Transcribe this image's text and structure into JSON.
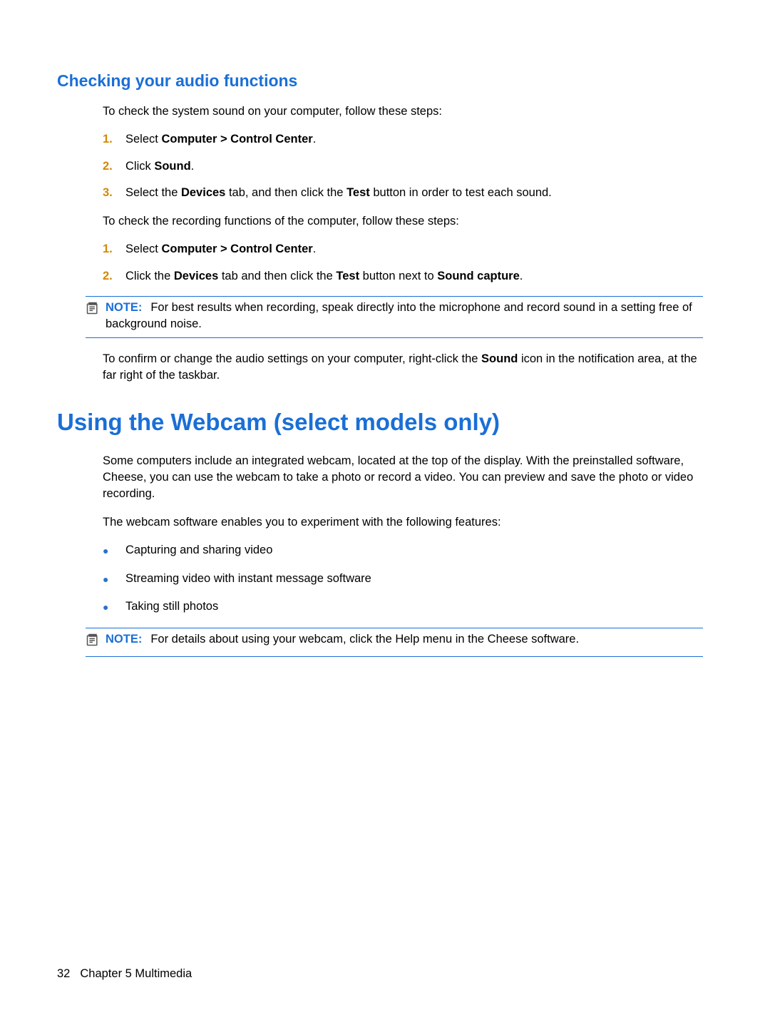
{
  "section1": {
    "heading": "Checking your audio functions",
    "intro": "To check the system sound on your computer, follow these steps:",
    "steps_a": [
      {
        "num": "1.",
        "pre": "Select ",
        "bold": "Computer > Control Center",
        "post": "."
      },
      {
        "num": "2.",
        "pre": "Click ",
        "bold": "Sound",
        "post": "."
      },
      {
        "num": "3.",
        "pre": "Select the ",
        "bold": "Devices",
        "mid": " tab, and then click the ",
        "bold2": "Test",
        "post": " button in order to test each sound."
      }
    ],
    "mid": "To check the recording functions of the computer, follow these steps:",
    "steps_b": [
      {
        "num": "1.",
        "pre": "Select ",
        "bold": "Computer > Control Center",
        "post": "."
      },
      {
        "num": "2.",
        "pre": "Click the ",
        "bold": "Devices",
        "mid": " tab and then click the ",
        "bold2": "Test",
        "mid2": " button next to ",
        "bold3": "Sound capture",
        "post": "."
      }
    ],
    "note": {
      "label": "NOTE:",
      "text": "For best results when recording, speak directly into the microphone and record sound in a setting free of background noise."
    },
    "outro_pre": "To confirm or change the audio settings on your computer, right-click the ",
    "outro_bold": "Sound",
    "outro_post": " icon in the notification area, at the far right of the taskbar."
  },
  "section2": {
    "heading": "Using the Webcam (select models only)",
    "para1": "Some computers include an integrated webcam, located at the top of the display. With the preinstalled software, Cheese, you can use the webcam to take a photo or record a video. You can preview and save the photo or video recording.",
    "para2": "The webcam software enables you to experiment with the following features:",
    "bullets": [
      "Capturing and sharing video",
      "Streaming video with instant message software",
      "Taking still photos"
    ],
    "note": {
      "label": "NOTE:",
      "text": "For details about using your webcam, click the Help menu in the Cheese software."
    }
  },
  "footer": {
    "page": "32",
    "chapter": "Chapter 5   Multimedia"
  }
}
